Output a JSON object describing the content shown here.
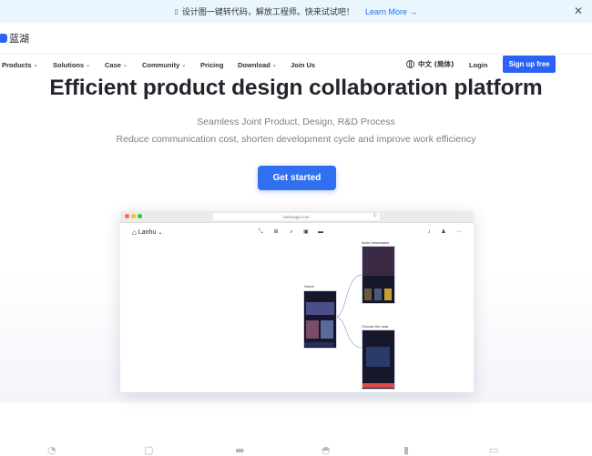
{
  "banner": {
    "icon": "info-icon",
    "message": "设计图一键转代码，解放工程师。快来试试吧！",
    "link": "Learn More →",
    "close": "✕"
  },
  "logo": {
    "text": "蓝湖"
  },
  "nav": {
    "items": [
      {
        "label": "Products",
        "dropdown": true
      },
      {
        "label": "Solutions",
        "dropdown": true
      },
      {
        "label": "Case",
        "dropdown": true
      },
      {
        "label": "Community",
        "dropdown": true
      },
      {
        "label": "Pricing",
        "dropdown": false
      },
      {
        "label": "Download",
        "dropdown": true
      },
      {
        "label": "Join Us",
        "dropdown": false
      }
    ],
    "language": "中文 (简体)",
    "login": "Login",
    "signup": "Sign up free"
  },
  "hero": {
    "title": "Efficient product design collaboration platform",
    "subtitle1": "Seamless Joint Product, Design, R&D Process",
    "subtitle2": "Reduce communication cost, shorten development cycle and improve work efficiency",
    "cta": "Get started"
  },
  "mock": {
    "url": "lanhuapp.com",
    "project": "Lanhu",
    "artboards": {
      "home": "Home",
      "actor": "Actor information",
      "choose": "Choose the seat"
    }
  },
  "colors": {
    "brand": "#2a62f5",
    "cta": "#2f6ff0",
    "banner_bg": "#e9f6fd"
  }
}
